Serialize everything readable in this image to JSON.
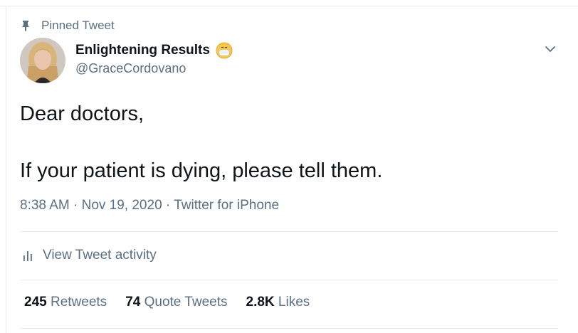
{
  "pinned": {
    "label": "Pinned Tweet",
    "icon": "pin-icon"
  },
  "author": {
    "display_name": "Enlightening Results",
    "handle": "@GraceCordovano",
    "name_emoji": "face-with-medical-mask-emoji"
  },
  "tweet": {
    "text": "Dear doctors,\n\nIf your patient is dying, please tell them."
  },
  "meta": {
    "time": "8:38 AM",
    "date": "Nov 19, 2020",
    "source": "Twitter for iPhone",
    "separator": " · "
  },
  "activity": {
    "label": "View Tweet activity",
    "icon": "bar-chart-icon"
  },
  "stats": {
    "retweets_count": "245",
    "retweets_label": "Retweets",
    "quotes_count": "74",
    "quotes_label": "Quote Tweets",
    "likes_count": "2.8K",
    "likes_label": "Likes"
  },
  "colors": {
    "text_primary": "#0f1419",
    "text_secondary": "#5b7083",
    "divider": "#e6ecf0"
  }
}
